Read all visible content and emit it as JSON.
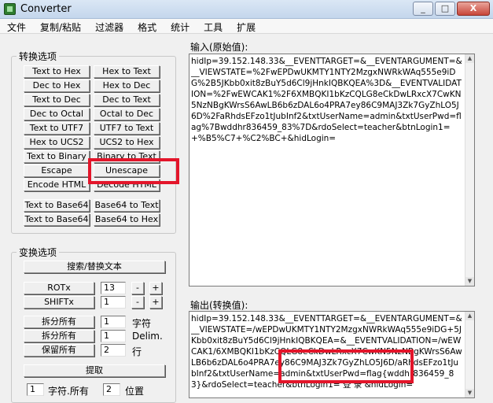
{
  "window": {
    "title": "Converter",
    "min": "_",
    "max": "□",
    "close": "X"
  },
  "menu": [
    "文件",
    "复制/粘贴",
    "过滤器",
    "格式",
    "统计",
    "工具",
    "扩展"
  ],
  "conversion": {
    "legend": "转换选项",
    "buttons": [
      [
        "Text to Hex",
        "Hex to Text"
      ],
      [
        "Dec to Hex",
        "Hex to Dec"
      ],
      [
        "Text to Dec",
        "Dec to Text"
      ],
      [
        "Dec to Octal",
        "Octal to Dec"
      ],
      [
        "Text to UTF7",
        "UTF7 to Text"
      ],
      [
        "Hex to UCS2",
        "UCS2 to Hex"
      ],
      [
        "Text to Binary",
        "Binary to Text"
      ],
      [
        "Escape",
        "Unescape"
      ],
      [
        "Encode HTML",
        "Decode HTML"
      ],
      [
        "Text to Base64",
        "Base64 to Text"
      ],
      [
        "Text to Base64",
        "Base64 to Hex"
      ]
    ]
  },
  "transform": {
    "legend": "变换选项",
    "search_replace": "搜索/替换文本",
    "rotx": {
      "label": "ROTx",
      "value": "13",
      "minus": "-",
      "plus": "+"
    },
    "shiftx": {
      "label": "SHIFTx",
      "value": "1",
      "minus": "-",
      "plus": "+"
    },
    "split_char": {
      "label": "拆分所有",
      "value": "1",
      "unit": "字符"
    },
    "split_delim": {
      "label": "拆分所有",
      "value": "1",
      "unit": "Delim."
    },
    "keep_all": {
      "label": "保留所有",
      "value": "2",
      "unit": "行"
    },
    "extract": "提取",
    "extract_count": "1",
    "extract_unit": "字符.所有",
    "extract_pos": "2",
    "extract_pos_unit": "位置"
  },
  "input": {
    "label": "输入(原始值):",
    "value": "hidIp=39.152.148.33&__EVENTTARGET=&__EVENTARGUMENT=&__VIEWSTATE=%2FwEPDwUKMTY1NTY2MzgxNWRkWAq555e9iDG%2B5JKbb0xit8zBuY5d6Cl9jHnkIQBKQEA%3D&__EVENTVALIDATION=%2FwEWCAK1%2F6XMBQKI1bKzCQLG8eCkDwLRxcX7CwKN5NzNBgKWrsS6AwLB6b6zDAL6o4PRA7ey86C9MAJ3Zk7GyZhLO5J6D%2FaRhdsEFzo1tJubInf2&txtUserName=admin&txtUserPwd=flag%7Bwddhr836459_83%7D&rdoSelect=teacher&btnLogin1=+%B5%C7+%C2%BC+&hidLogin="
  },
  "output": {
    "label": "输出(转换值):",
    "value": "hidIp=39.152.148.33&__EVENTTARGET=&__EVENTARGUMENT=&__VIEWSTATE=/wEPDwUKMTY1NTY2MzgxNWRkWAq555e9iDG+5JKbb0xit8zBuY5d6Cl9jHnkIQBKQEA=&__EVENTVALIDATION=/wEWCAK1/6XMBQKI1bKzCQLG8eCkDwLRxcX7CwKN5NzNBgKWrsS6AwLB6b6zDAL6o4PRA7ey86C9MAJ3Zk7GyZhLO5J6D/aRhdsEFzo1tJubInf2&txtUserName=admin&txtUserPwd=flag{wddhr836459_83}&rdoSelect=teacher&btnLogin1= 登 录 &hidLogin="
  },
  "highlight_color": "#e3152a"
}
